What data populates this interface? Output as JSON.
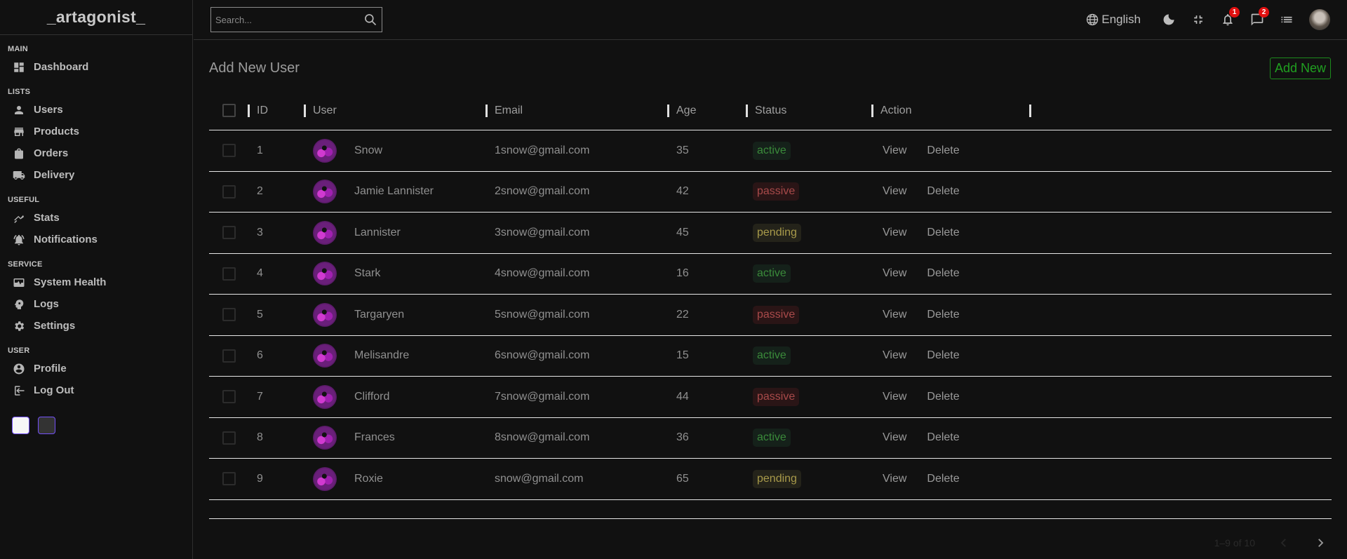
{
  "sidebar": {
    "logo": "_artagonist_",
    "sections": [
      {
        "title": "MAIN",
        "items": [
          {
            "label": "Dashboard",
            "icon": "dashboard-icon"
          }
        ]
      },
      {
        "title": "LISTS",
        "items": [
          {
            "label": "Users",
            "icon": "person-icon"
          },
          {
            "label": "Products",
            "icon": "store-icon"
          },
          {
            "label": "Orders",
            "icon": "bag-icon"
          },
          {
            "label": "Delivery",
            "icon": "truck-icon"
          }
        ]
      },
      {
        "title": "USEFUL",
        "items": [
          {
            "label": "Stats",
            "icon": "chart-icon"
          },
          {
            "label": "Notifications",
            "icon": "bell-icon"
          }
        ]
      },
      {
        "title": "SERVICE",
        "items": [
          {
            "label": "System Health",
            "icon": "health-icon"
          },
          {
            "label": "Logs",
            "icon": "psychology-icon"
          },
          {
            "label": "Settings",
            "icon": "gear-icon"
          }
        ]
      },
      {
        "title": "USER",
        "items": [
          {
            "label": "Profile",
            "icon": "account-circle-icon"
          },
          {
            "label": "Log Out",
            "icon": "logout-icon"
          }
        ]
      }
    ]
  },
  "topbar": {
    "search_placeholder": "Search...",
    "language": "English",
    "notifications_count": "1",
    "messages_count": "2"
  },
  "main": {
    "title": "Add New User",
    "add_new_label": "Add New",
    "columns": [
      "ID",
      "User",
      "Email",
      "Age",
      "Status",
      "Action"
    ],
    "rows": [
      {
        "id": "1",
        "user": "Snow",
        "email": "1snow@gmail.com",
        "age": "35",
        "status": "active"
      },
      {
        "id": "2",
        "user": "Jamie Lannister",
        "email": "2snow@gmail.com",
        "age": "42",
        "status": "passive"
      },
      {
        "id": "3",
        "user": "Lannister",
        "email": "3snow@gmail.com",
        "age": "45",
        "status": "pending"
      },
      {
        "id": "4",
        "user": "Stark",
        "email": "4snow@gmail.com",
        "age": "16",
        "status": "active"
      },
      {
        "id": "5",
        "user": "Targaryen",
        "email": "5snow@gmail.com",
        "age": "22",
        "status": "passive"
      },
      {
        "id": "6",
        "user": "Melisandre",
        "email": "6snow@gmail.com",
        "age": "15",
        "status": "active"
      },
      {
        "id": "7",
        "user": "Clifford",
        "email": "7snow@gmail.com",
        "age": "44",
        "status": "passive"
      },
      {
        "id": "8",
        "user": "Frances",
        "email": "8snow@gmail.com",
        "age": "36",
        "status": "active"
      },
      {
        "id": "9",
        "user": "Roxie",
        "email": "snow@gmail.com",
        "age": "65",
        "status": "pending"
      }
    ],
    "view_label": "View",
    "delete_label": "Delete",
    "pagination_text": "1–9 of 10"
  },
  "colors": {
    "accent": "#7451f8",
    "active": "#3a8a3a",
    "passive": "#a84a4a",
    "pending": "#a89a4a",
    "add_new": "#20a020",
    "badge": "#e01010"
  }
}
